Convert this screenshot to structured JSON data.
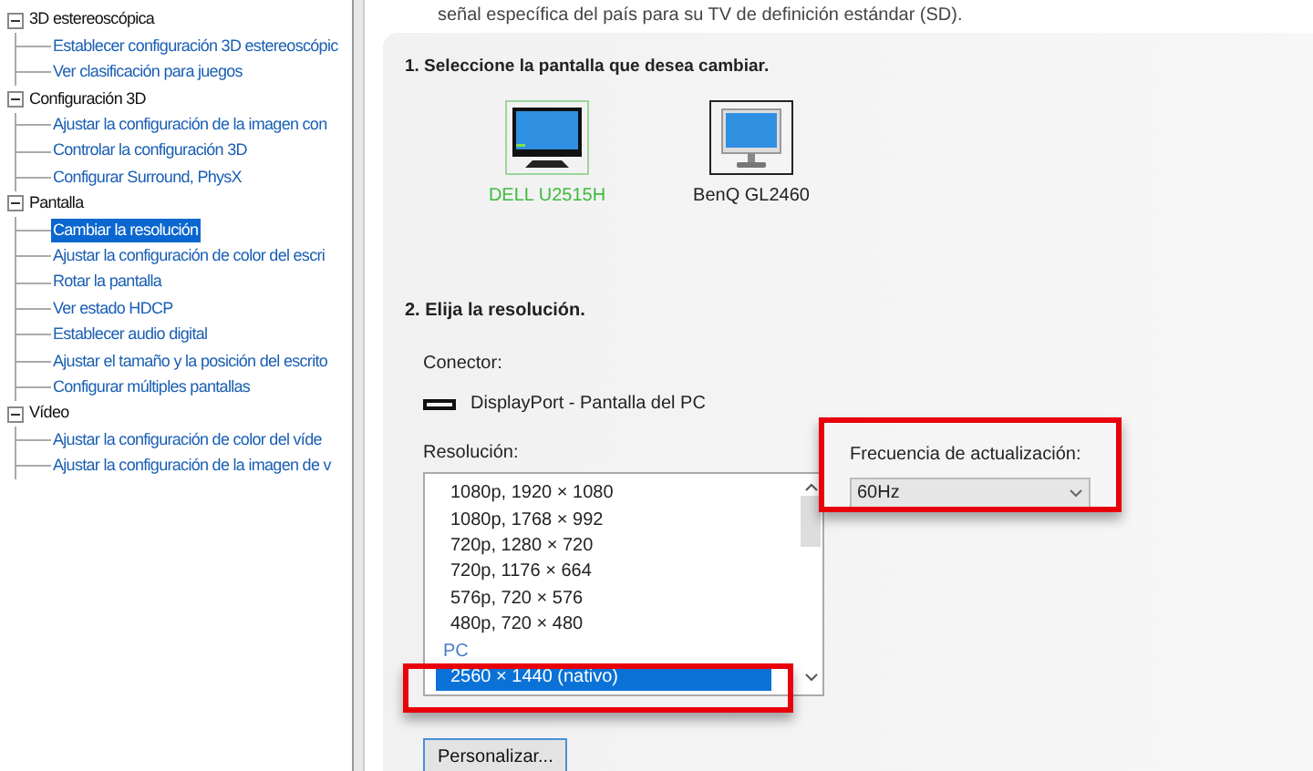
{
  "tree": [
    {
      "label": "3D estereoscópica",
      "expanded": true,
      "children": [
        {
          "label": "Establecer configuración 3D estereoscópic",
          "selected": false
        },
        {
          "label": "Ver clasificación para juegos",
          "selected": false
        }
      ]
    },
    {
      "label": "Configuración 3D",
      "expanded": true,
      "children": [
        {
          "label": "Ajustar la configuración de la imagen con",
          "selected": false
        },
        {
          "label": "Controlar la configuración 3D",
          "selected": false
        },
        {
          "label": "Configurar Surround, PhysX",
          "selected": false
        }
      ]
    },
    {
      "label": "Pantalla",
      "expanded": true,
      "children": [
        {
          "label": "Cambiar la resolución",
          "selected": true
        },
        {
          "label": "Ajustar la configuración de color del escri",
          "selected": false
        },
        {
          "label": "Rotar la pantalla",
          "selected": false
        },
        {
          "label": "Ver estado HDCP",
          "selected": false
        },
        {
          "label": "Establecer audio digital",
          "selected": false
        },
        {
          "label": "Ajustar el tamaño y la posición del escrito",
          "selected": false
        },
        {
          "label": "Configurar múltiples pantallas",
          "selected": false
        }
      ]
    },
    {
      "label": "Vídeo",
      "expanded": true,
      "children": [
        {
          "label": "Ajustar la configuración de color del víde",
          "selected": false
        },
        {
          "label": "Ajustar la configuración de la imagen de v",
          "selected": false
        }
      ]
    }
  ],
  "intro": "señal específica del país para su TV de definición estándar (SD).",
  "step1": "1. Seleccione la pantalla que desea cambiar.",
  "displays": [
    {
      "name": "DELL U2515H",
      "selected": true
    },
    {
      "name": "BenQ GL2460",
      "selected": false
    }
  ],
  "step2": "2. Elija la resolución.",
  "connector_label": "Conector:",
  "connector": "DisplayPort - Pantalla del PC",
  "resolution_label": "Resolución:",
  "resolutions": [
    {
      "kind": "item",
      "label": "1080p, 1920 × 1080",
      "selected": false
    },
    {
      "kind": "item",
      "label": "1080p, 1768 × 992",
      "selected": false
    },
    {
      "kind": "item",
      "label": "720p, 1280 × 720",
      "selected": false
    },
    {
      "kind": "item",
      "label": "720p, 1176 × 664",
      "selected": false
    },
    {
      "kind": "item",
      "label": "576p, 720 × 576",
      "selected": false
    },
    {
      "kind": "item",
      "label": "480p, 720 × 480",
      "selected": false
    },
    {
      "kind": "group",
      "label": "PC"
    },
    {
      "kind": "item",
      "label": "2560 × 1440 (nativo)",
      "selected": true
    }
  ],
  "refresh_label": "Frecuencia de actualización:",
  "refresh_value": "60Hz",
  "customize_button": "Personalizar..."
}
